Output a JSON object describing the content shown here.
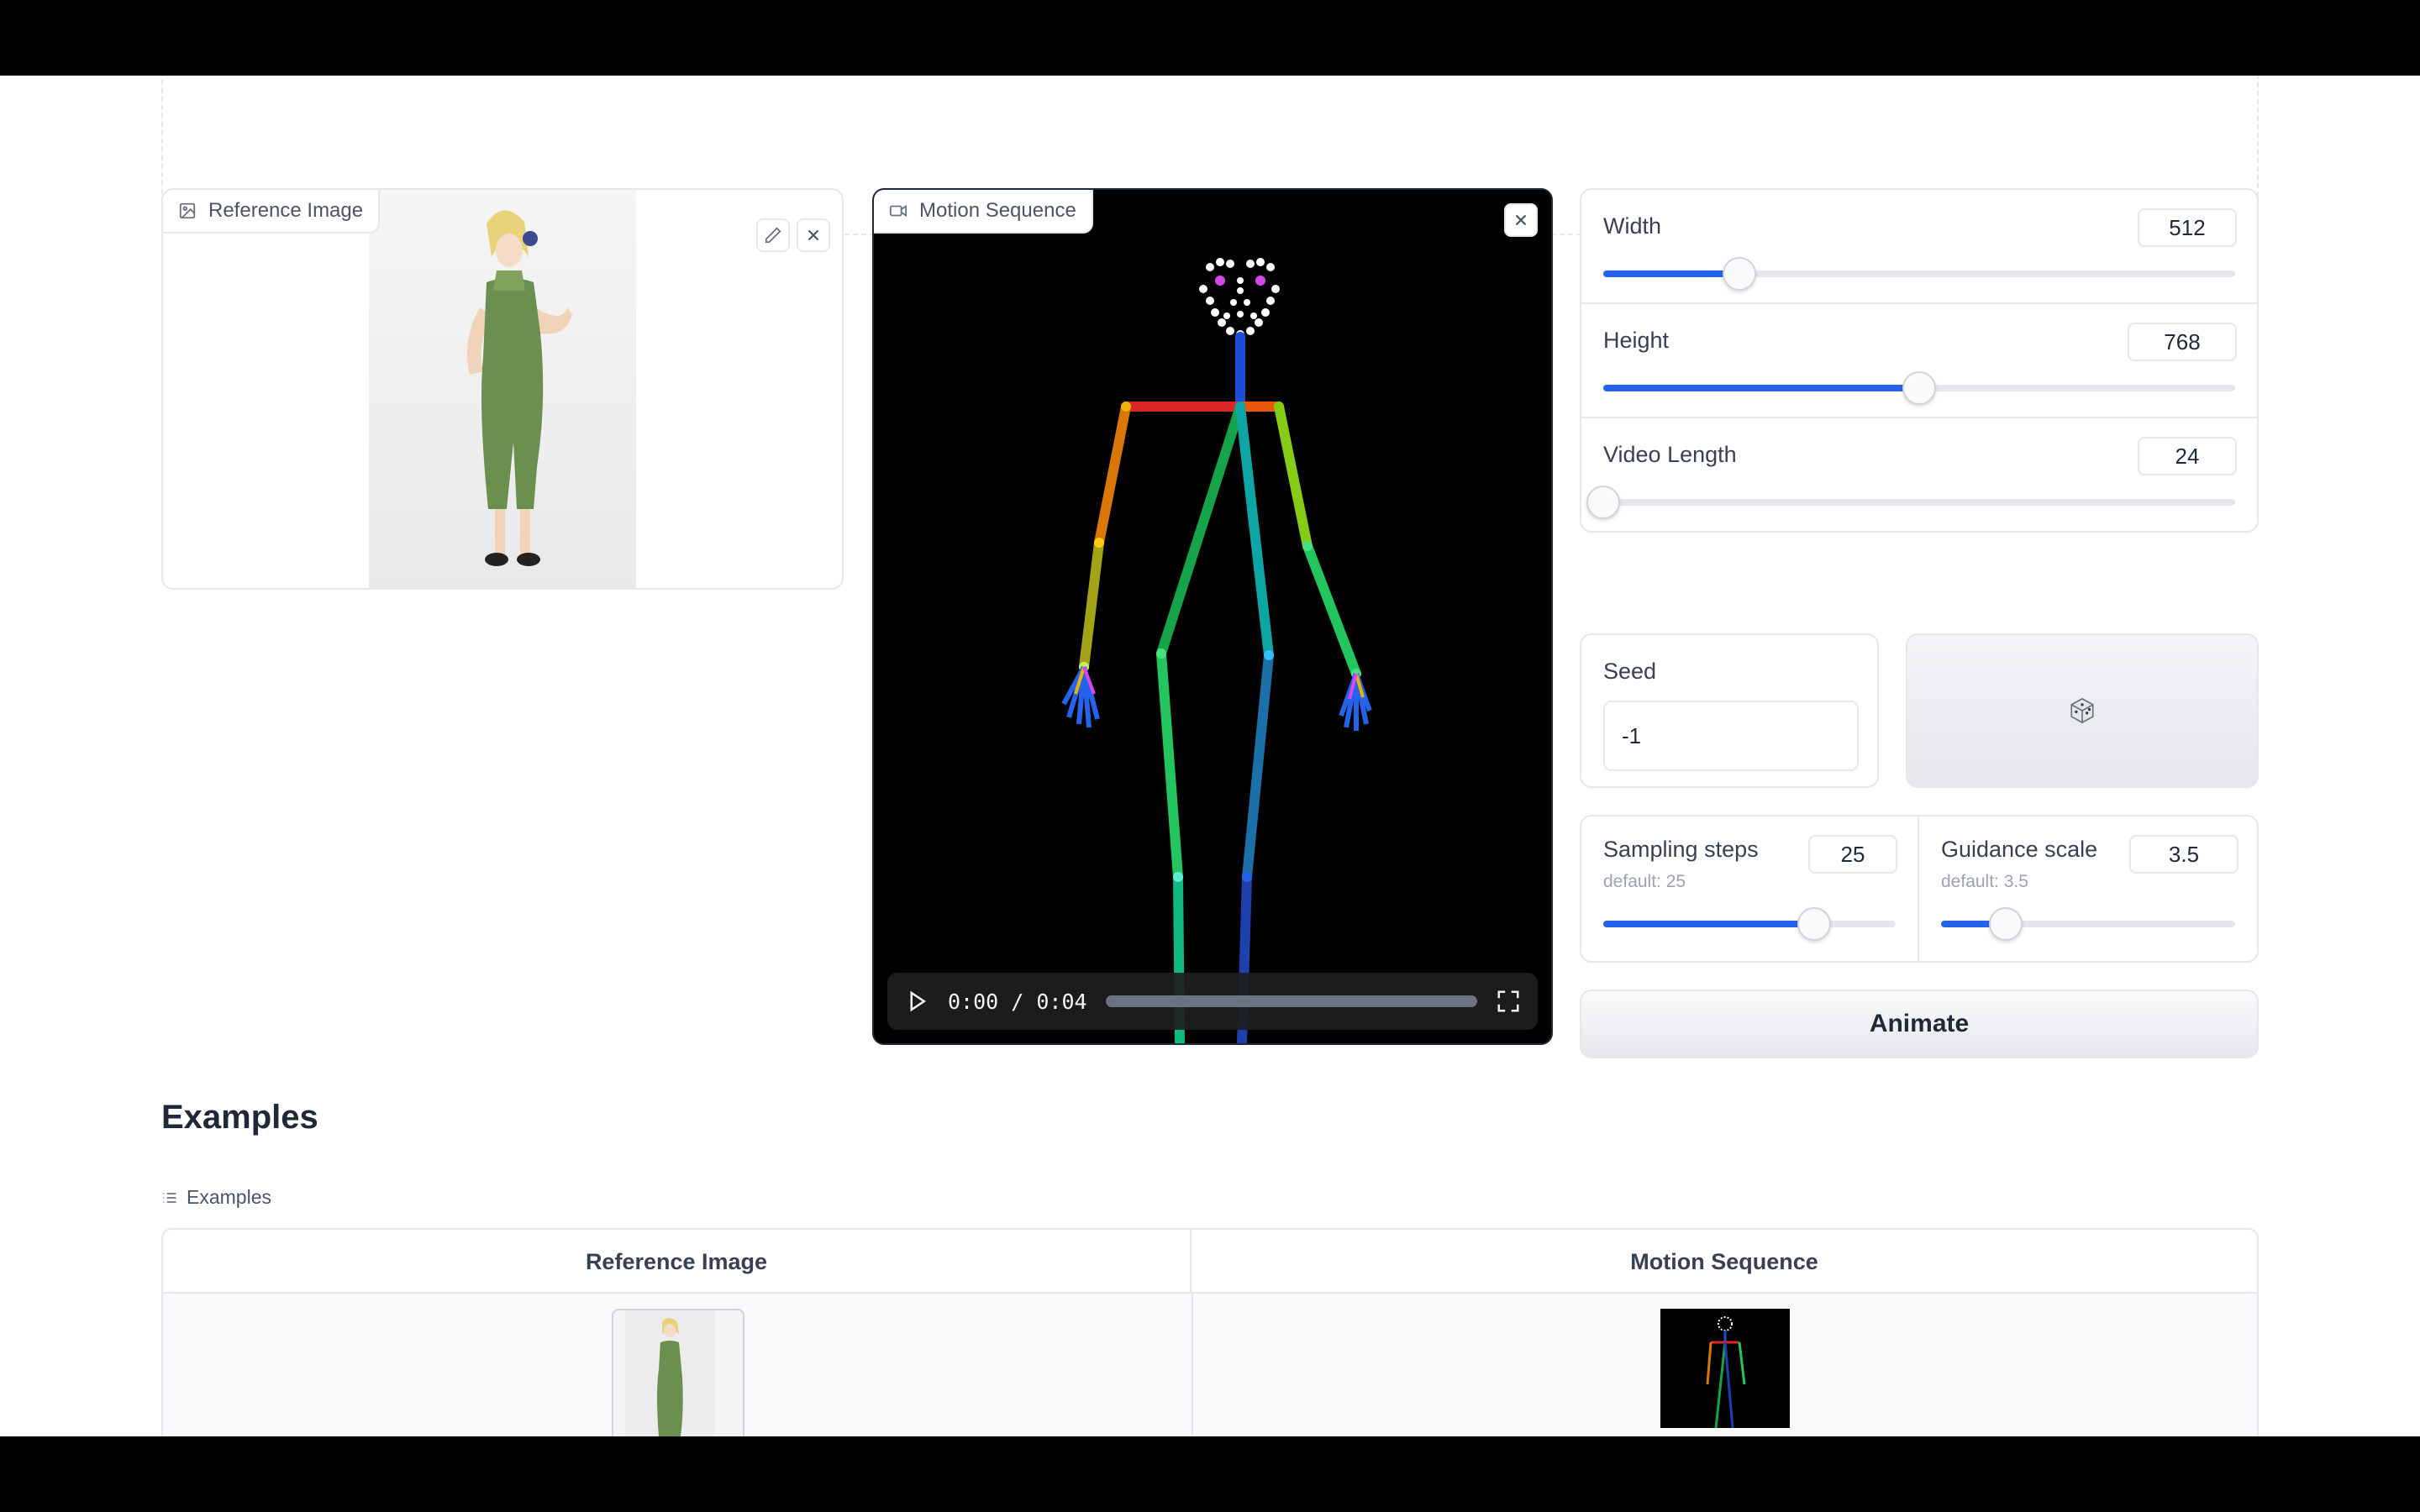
{
  "reference_image": {
    "label": "Reference Image",
    "icons": [
      "image-icon",
      "pencil-icon",
      "close-icon"
    ]
  },
  "motion_sequence": {
    "label": "Motion Sequence",
    "time": "0:00 / 0:04",
    "progress": 0.0,
    "icons": [
      "video-icon",
      "close-icon",
      "play-icon",
      "fullscreen-icon"
    ]
  },
  "settings": {
    "width": {
      "label": "Width",
      "value": "512",
      "fraction": 0.215
    },
    "height": {
      "label": "Height",
      "value": "768",
      "fraction": 0.5
    },
    "video_length": {
      "label": "Video Length",
      "value": "24",
      "fraction": 0.0
    },
    "seed": {
      "label": "Seed",
      "value": "-1"
    },
    "dice_icon": "dice-icon",
    "sampling_steps": {
      "label": "Sampling steps",
      "default": "default: 25",
      "value": "25",
      "fraction": 0.72
    },
    "guidance_scale": {
      "label": "Guidance scale",
      "default": "default: 3.5",
      "value": "3.5",
      "fraction": 0.22
    }
  },
  "animate_label": "Animate",
  "examples": {
    "title": "Examples",
    "label": "Examples",
    "columns": [
      "Reference Image",
      "Motion Sequence"
    ]
  }
}
